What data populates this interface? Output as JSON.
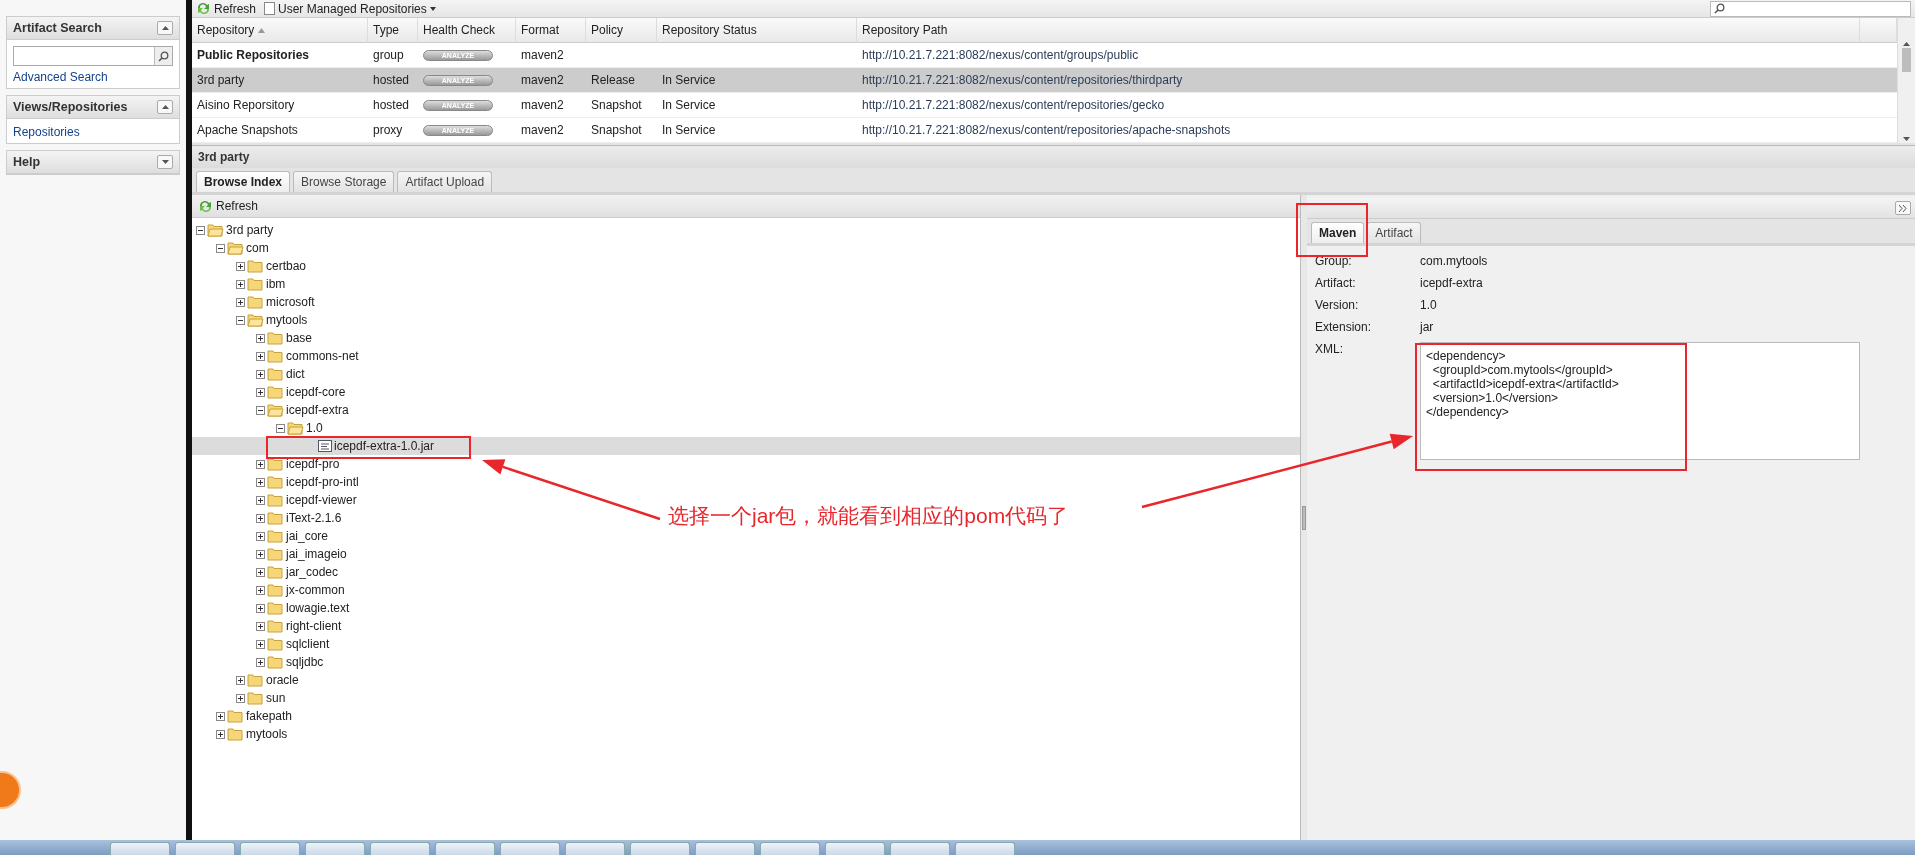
{
  "sidebar": {
    "panels": [
      {
        "title": "Artifact Search",
        "collapsed": false,
        "items": [
          {
            "kind": "search"
          },
          {
            "kind": "link",
            "label": "Advanced Search"
          }
        ]
      },
      {
        "title": "Views/Repositories",
        "collapsed": false,
        "items": [
          {
            "kind": "link",
            "label": "Repositories"
          }
        ]
      },
      {
        "title": "Help",
        "collapsed": true
      }
    ]
  },
  "toolbar": {
    "buttons": [
      {
        "kind": "refresh",
        "label": "Refresh"
      },
      {
        "kind": "dropdown",
        "label": "User Managed Repositories"
      }
    ]
  },
  "table": {
    "columns": [
      {
        "label": "Repository",
        "sort_ascending": true
      },
      {
        "label": "Type"
      },
      {
        "label": "Health Check"
      },
      {
        "label": "Format"
      },
      {
        "label": "Policy"
      },
      {
        "label": "Repository Status"
      },
      {
        "label": "Repository Path"
      }
    ],
    "rows": [
      {
        "kind": "group",
        "selected": false,
        "name": "Public Repositories",
        "type": "group",
        "health": "ANALYZE",
        "format": "maven2",
        "policy": "",
        "status": "",
        "path": "http://10.21.7.221:8082/nexus/content/groups/public"
      },
      {
        "kind": "repository",
        "selected": true,
        "name": "3rd party",
        "type": "hosted",
        "health": "ANALYZE",
        "format": "maven2",
        "policy": "Release",
        "status": "In Service",
        "path": "http://10.21.7.221:8082/nexus/content/repositories/thirdparty"
      },
      {
        "kind": "repository",
        "selected": false,
        "name": "Aisino Reporsitory",
        "type": "hosted",
        "health": "ANALYZE",
        "format": "maven2",
        "policy": "Snapshot",
        "status": "In Service",
        "path": "http://10.21.7.221:8082/nexus/content/repositories/gecko"
      },
      {
        "kind": "repository",
        "selected": false,
        "name": "Apache Snapshots",
        "type": "proxy",
        "health": "ANALYZE",
        "format": "maven2",
        "policy": "Snapshot",
        "status": "In Service",
        "path": "http://10.21.7.221:8082/nexus/content/repositories/apache-snapshots"
      }
    ]
  },
  "detail": {
    "title": "3rd party",
    "tabs": [
      {
        "label": "Browse Index",
        "selected": true
      },
      {
        "label": "Browse Storage",
        "selected": false
      },
      {
        "label": "Artifact Upload",
        "selected": false
      }
    ],
    "refresh": "Refresh",
    "tree": [
      {
        "label": "3rd party",
        "kind": "folder",
        "expanded": true,
        "selected": false,
        "children": [
          {
            "label": "com",
            "kind": "folder",
            "expanded": true,
            "selected": false,
            "children": [
              {
                "label": "certbao",
                "kind": "folder",
                "expanded": false,
                "selected": false
              },
              {
                "label": "ibm",
                "kind": "folder",
                "expanded": false,
                "selected": false
              },
              {
                "label": "microsoft",
                "kind": "folder",
                "expanded": false,
                "selected": false
              },
              {
                "label": "mytools",
                "kind": "folder",
                "expanded": true,
                "selected": false,
                "children": [
                  {
                    "label": "base",
                    "kind": "folder",
                    "expanded": false,
                    "selected": false
                  },
                  {
                    "label": "commons-net",
                    "kind": "folder",
                    "expanded": false,
                    "selected": false
                  },
                  {
                    "label": "dict",
                    "kind": "folder",
                    "expanded": false,
                    "selected": false
                  },
                  {
                    "label": "icepdf-core",
                    "kind": "folder",
                    "expanded": false,
                    "selected": false
                  },
                  {
                    "label": "icepdf-extra",
                    "kind": "folder",
                    "expanded": true,
                    "selected": false,
                    "children": [
                      {
                        "label": "1.0",
                        "kind": "folder",
                        "expanded": true,
                        "selected": false,
                        "children": [
                          {
                            "label": "icepdf-extra-1.0.jar",
                            "kind": "file",
                            "selected": true
                          }
                        ]
                      }
                    ]
                  },
                  {
                    "label": "icepdf-pro",
                    "kind": "folder",
                    "expanded": false,
                    "selected": false
                  },
                  {
                    "label": "icepdf-pro-intl",
                    "kind": "folder",
                    "expanded": false,
                    "selected": false
                  },
                  {
                    "label": "icepdf-viewer",
                    "kind": "folder",
                    "expanded": false,
                    "selected": false
                  },
                  {
                    "label": "iText-2.1.6",
                    "kind": "folder",
                    "expanded": false,
                    "selected": false
                  },
                  {
                    "label": "jai_core",
                    "kind": "folder",
                    "expanded": false,
                    "selected": false
                  },
                  {
                    "label": "jai_imageio",
                    "kind": "folder",
                    "expanded": false,
                    "selected": false
                  },
                  {
                    "label": "jar_codec",
                    "kind": "folder",
                    "expanded": false,
                    "selected": false
                  },
                  {
                    "label": "jx-common",
                    "kind": "folder",
                    "expanded": false,
                    "selected": false
                  },
                  {
                    "label": "lowagie.text",
                    "kind": "folder",
                    "expanded": false,
                    "selected": false
                  },
                  {
                    "label": "right-client",
                    "kind": "folder",
                    "expanded": false,
                    "selected": false
                  },
                  {
                    "label": "sqlclient",
                    "kind": "folder",
                    "expanded": false,
                    "selected": false
                  },
                  {
                    "label": "sqljdbc",
                    "kind": "folder",
                    "expanded": false,
                    "selected": false
                  }
                ]
              },
              {
                "label": "oracle",
                "kind": "folder",
                "expanded": false,
                "selected": false
              },
              {
                "label": "sun",
                "kind": "folder",
                "expanded": false,
                "selected": false
              }
            ]
          },
          {
            "label": "fakepath",
            "kind": "folder",
            "expanded": false,
            "selected": false
          },
          {
            "label": "mytools",
            "kind": "folder",
            "expanded": false,
            "selected": false
          }
        ]
      }
    ],
    "info": {
      "tabs": [
        {
          "label": "Maven",
          "selected": true
        },
        {
          "label": "Artifact",
          "selected": false
        }
      ],
      "fields": [
        {
          "label": "Group:",
          "value": "com.mytools"
        },
        {
          "label": "Artifact:",
          "value": "icepdf-extra"
        },
        {
          "label": "Version:",
          "value": "1.0"
        },
        {
          "label": "Extension:",
          "value": "jar"
        }
      ],
      "xml": {
        "label": "XML:",
        "value": "<dependency>\n  <groupId>com.mytools</groupId>\n  <artifactId>icepdf-extra</artifactId>\n  <version>1.0</version>\n</dependency>"
      }
    }
  },
  "annotation": {
    "text": "选择一个jar包，就能看到相应的pom代码了"
  }
}
